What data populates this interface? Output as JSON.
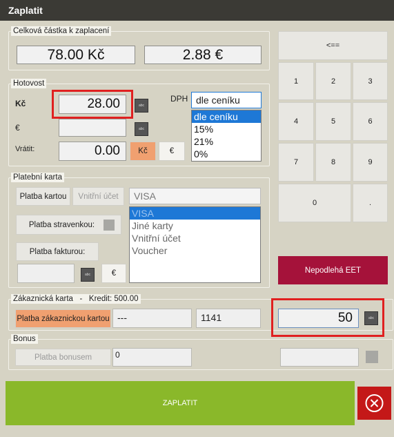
{
  "window": {
    "title": "Zaplatit"
  },
  "total": {
    "title": "Celková částka k zaplacení",
    "czk": "78.00 Kč",
    "eur": "2.88 €"
  },
  "cash": {
    "title": "Hotovost",
    "czk_label": "Kč",
    "czk_value": "28.00",
    "eur_label": "€",
    "eur_value": "",
    "change_label": "Vrátit:",
    "change_value": "0.00",
    "btn_czk": "Kč",
    "btn_eur": "€",
    "vat_label": "DPH",
    "vat_selected": "dle ceníku",
    "vat_options": [
      "dle ceníku",
      "15%",
      "21%",
      "0%"
    ]
  },
  "card": {
    "title": "Platební karta",
    "pay_card": "Platba kartou",
    "internal_account": "Vnitřní účet",
    "meal_voucher": "Platba stravenkou:",
    "invoice": "Platba fakturou:",
    "eur_btn": "€",
    "card_type_selected": "VISA",
    "card_types": [
      "VISA",
      "Jiné karty",
      "Vnitřní účet",
      "Voucher"
    ]
  },
  "customer": {
    "title": "Zákaznická karta   -   Kredit: 500.00",
    "pay_button": "Platba zákaznickou kartou",
    "field1": "---",
    "field2": "1141",
    "amount": "50"
  },
  "bonus": {
    "title": "Bonus",
    "pay_button": "Platba bonusem",
    "value": "0"
  },
  "numpad": {
    "backspace": "<==",
    "keys": [
      "1",
      "2",
      "3",
      "4",
      "5",
      "6",
      "7",
      "8",
      "9",
      "0",
      "."
    ]
  },
  "eet": {
    "label": "Nepodlehá EET"
  },
  "pay": {
    "label": "ZAPLATIT"
  },
  "colors": {
    "pay": "#8ab82a",
    "eet": "#a5123a",
    "close": "#c41818",
    "orange": "#f0a070",
    "highlight": "#e02020"
  }
}
